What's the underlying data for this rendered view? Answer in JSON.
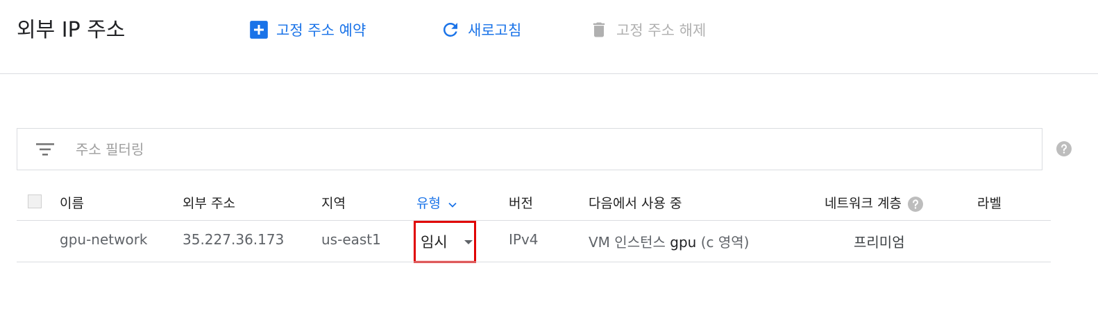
{
  "header": {
    "title": "외부 IP 주소",
    "actions": {
      "reserve": {
        "label": "고정 주소 예약",
        "icon": "add-box-icon"
      },
      "refresh": {
        "label": "새로고침",
        "icon": "refresh-icon"
      },
      "release": {
        "label": "고정 주소 해제",
        "icon": "delete-icon",
        "disabled": true
      }
    }
  },
  "filter": {
    "placeholder": "주소 필터링",
    "icon": "filter-list-icon"
  },
  "table": {
    "columns": {
      "name": "이름",
      "external_address": "외부 주소",
      "region": "지역",
      "type": "유형",
      "version": "버전",
      "in_use_by": "다음에서 사용 중",
      "network_tier": "네트워크 계층",
      "labels": "라벨"
    },
    "rows": [
      {
        "name": "gpu-network",
        "external_address": "35.227.36.173",
        "region": "us-east1",
        "type": "임시",
        "version": "IPv4",
        "in_use_by_prefix": "VM 인스턴스",
        "in_use_by_name": "gpu",
        "in_use_by_suffix": "(c 영역)",
        "network_tier": "프리미엄",
        "labels": ""
      }
    ]
  },
  "colors": {
    "accent": "#1a73e8",
    "highlight": "#e00000",
    "disabled": "#b0b0b0"
  }
}
